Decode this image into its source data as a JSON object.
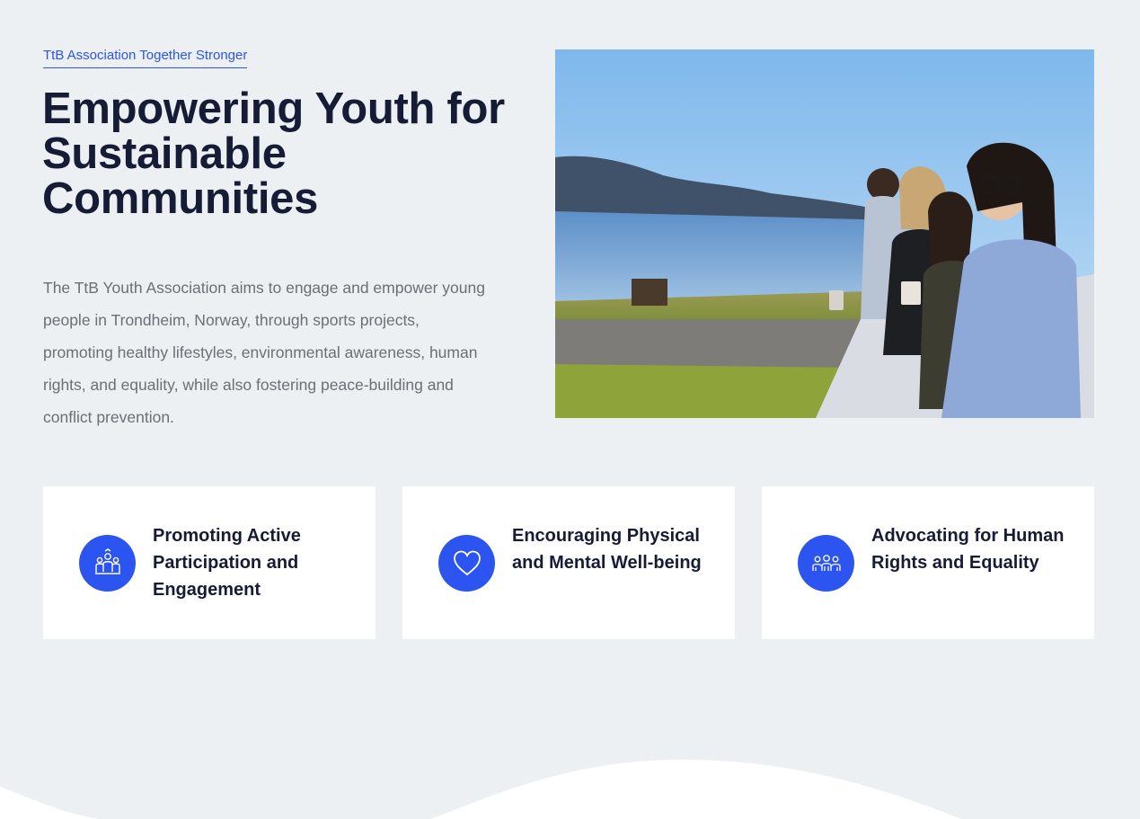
{
  "hero": {
    "tagline": "TtB Association Together Stronger",
    "title": "Empowering Youth for Sustainable Communities",
    "description": "The TtB Youth Association aims to engage and empower young people in Trondheim, Norway, through sports projects, promoting healthy lifestyles, environmental awareness, human rights, and equality, while also fostering peace-building and conflict prevention.",
    "image_icon": "group-photo-by-lake"
  },
  "features": [
    {
      "label": "Promoting Active Participation and Engagement",
      "icon": "team-icon"
    },
    {
      "label": "Encouraging Physical and Mental Well-being",
      "icon": "heart-icon"
    },
    {
      "label": "Advocating for Human Rights and Equality",
      "icon": "people-group-icon"
    }
  ],
  "colors": {
    "accent": "#2b54f0",
    "background": "#edf0f3",
    "heading": "#161c36",
    "body_text": "#6b6f76",
    "card": "#ffffff"
  }
}
